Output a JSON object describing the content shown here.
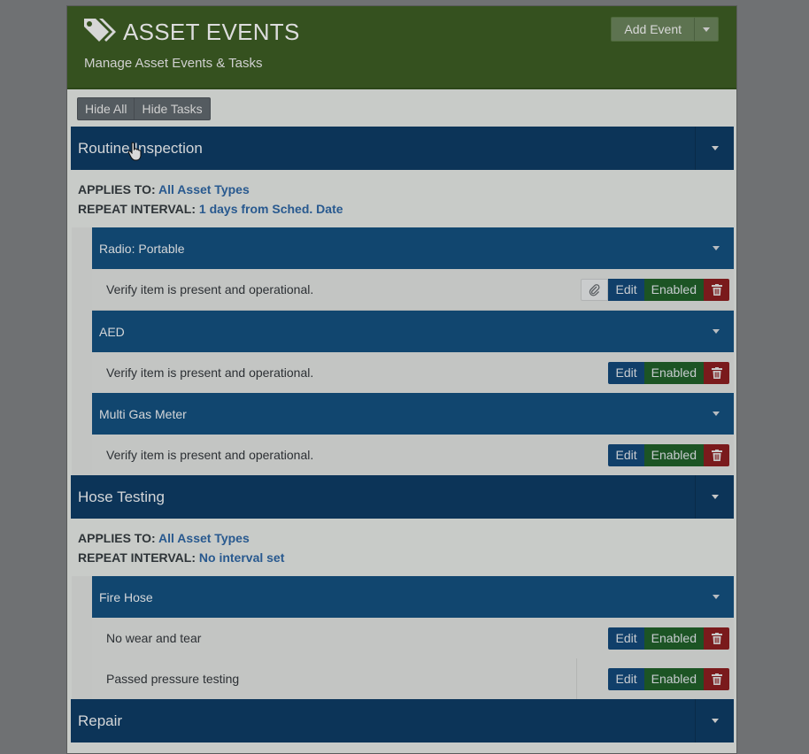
{
  "header": {
    "title": "ASSET EVENTS",
    "subtitle": "Manage Asset Events & Tasks",
    "add_button": "Add Event"
  },
  "toolbar": {
    "hide_all": "Hide All",
    "hide_tasks": "Hide Tasks"
  },
  "labels": {
    "applies_to": "APPLIES TO:",
    "repeat_interval": "REPEAT INTERVAL:"
  },
  "actions": {
    "edit": "Edit",
    "enabled": "Enabled"
  },
  "events": [
    {
      "name": "Routine Inspection",
      "applies_to": "All Asset Types",
      "repeat": "1 days from Sched. Date",
      "groups": [
        {
          "name": "Radio: Portable",
          "tasks": [
            "Verify item is present and operational."
          ]
        },
        {
          "name": "AED",
          "tasks": [
            "Verify item is present and operational."
          ]
        },
        {
          "name": "Multi Gas Meter",
          "tasks": [
            "Verify item is present and operational."
          ]
        }
      ]
    },
    {
      "name": "Hose Testing",
      "applies_to": "All Asset Types",
      "repeat": "No interval set",
      "groups": [
        {
          "name": "Fire Hose",
          "tasks": [
            "No wear and tear",
            "Passed pressure testing"
          ]
        }
      ]
    },
    {
      "name": "Repair"
    }
  ],
  "colors": {
    "header_bg": "#35511f",
    "event_bar": "#0c3458",
    "group_bar": "#11466f",
    "edit": "#103f6a",
    "enabled": "#1c5424",
    "delete": "#7a1a1c"
  },
  "icons": [
    "tags-icon",
    "caret-down-icon",
    "paperclip-icon",
    "trash-icon",
    "hand-cursor-icon"
  ]
}
